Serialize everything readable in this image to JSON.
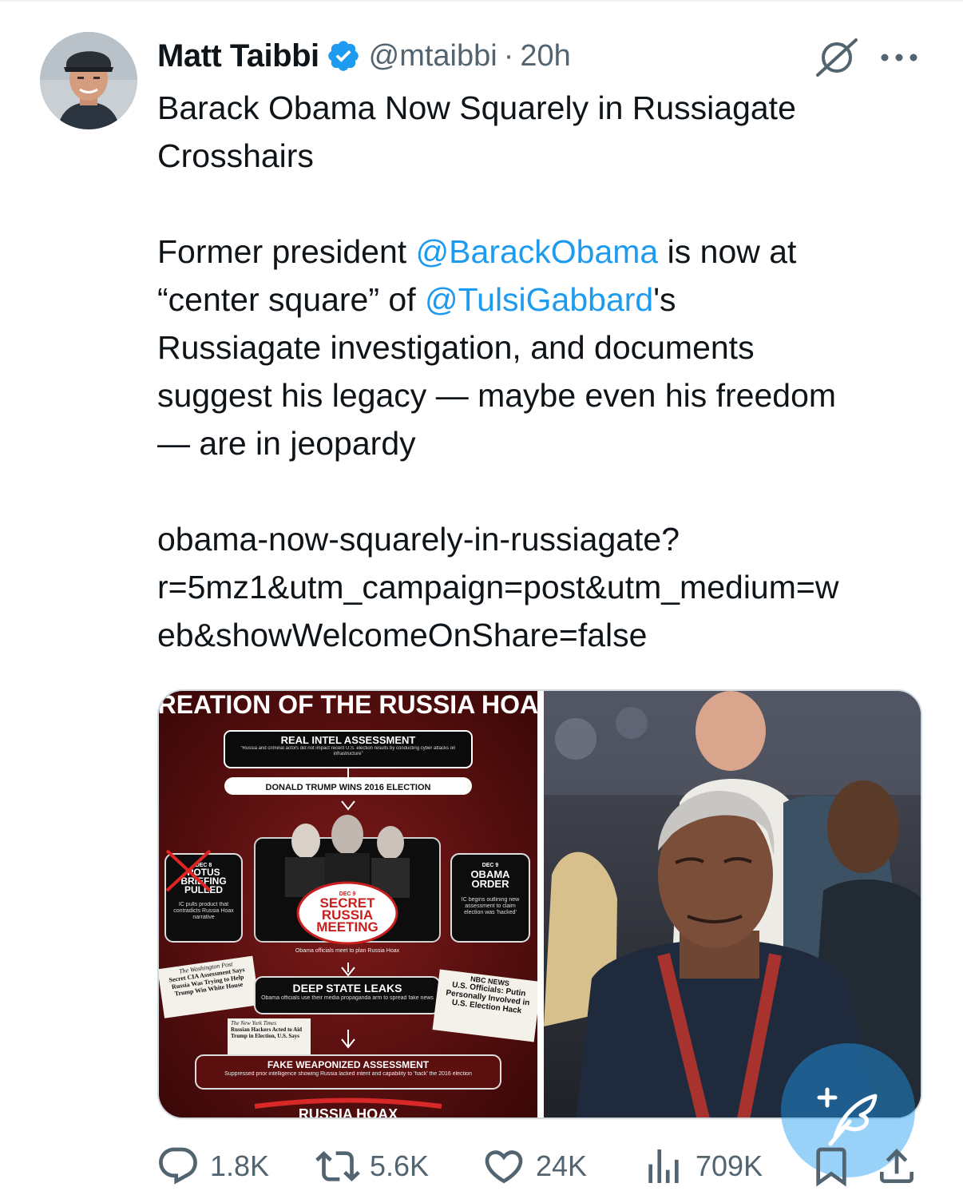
{
  "author": {
    "name": "Matt Taibbi",
    "handle": "@mtaibbi",
    "separator": "·",
    "time": "20h",
    "verified": true
  },
  "tweet": {
    "line1": "Barack Obama Now Squarely in Russiagate",
    "line2": "Crosshairs",
    "para2": {
      "l1_pre": "Former president ",
      "l1_mention": "@BarackObama",
      "l1_post": " is now at",
      "l2_pre": "“center square” of ",
      "l2_mention": "@TulsiGabbard",
      "l2_post": "'s",
      "l3": "Russiagate investigation, and documents",
      "l4": "suggest his legacy — maybe even his freedom",
      "l5": "— are in jeopardy"
    },
    "link": {
      "l1": "obama-now-squarely-in-russiagate?",
      "l2": "r=5mz1&utm_campaign=post&utm_medium=w",
      "l3": "eb&showWelcomeOnShare=false"
    }
  },
  "media": {
    "left": {
      "title": "CREATION OF THE RUSSIA HOAX",
      "box1_title": "REAL INTEL ASSESSMENT",
      "box1_sub": "“Russia and criminal actors did not impact recent U.S. election results by conducting cyber attacks on infrastructure”",
      "box2": "DONALD TRUMP WINS 2016 ELECTION",
      "left_date": "DEC 8",
      "left_title": "POTUS BRIEFING PULLED",
      "left_sub": "IC pulls product that contradicts Russia Hoax narrative",
      "right_date": "DEC 9",
      "right_title": "OBAMA ORDER",
      "right_sub": "IC begins outlining new assessment to claim election was 'hacked'",
      "center_date": "DEC 9",
      "center_title": "SECRET RUSSIA MEETING",
      "center_caption": "Obama officials meet to plan Russia Hoax",
      "wapo_name": "The Washington Post",
      "wapo_headline": "Secret CIA Assessment Says Russia Was Trying to Help Trump Win White House",
      "leaks_title": "DEEP STATE LEAKS",
      "leaks_sub": "Obama officials use their media propaganda arm to spread fake news",
      "nbc_name": "NBC NEWS",
      "nbc_headline": "U.S. Officials: Putin Personally Involved in U.S. Election Hack",
      "nyt_name": "The New York Times",
      "nyt_headline": "Russian Hackers Acted to Aid Trump in Election, U.S. Says",
      "fake_title": "FAKE WEAPONIZED ASSESSMENT",
      "fake_sub": "Suppressed prior intelligence showing Russia lacked intent and capability to 'hack' the 2016 election",
      "bottom": "RUSSIA HOAX"
    }
  },
  "actions": {
    "replies": "1.8K",
    "reposts": "5.6K",
    "likes": "24K",
    "views": "709K"
  },
  "colors": {
    "accent": "#1d9bf0",
    "secondary_text": "#536471",
    "text": "#0f1419",
    "verified": "#1d9bf0",
    "infographic_red": "#6e1414"
  }
}
